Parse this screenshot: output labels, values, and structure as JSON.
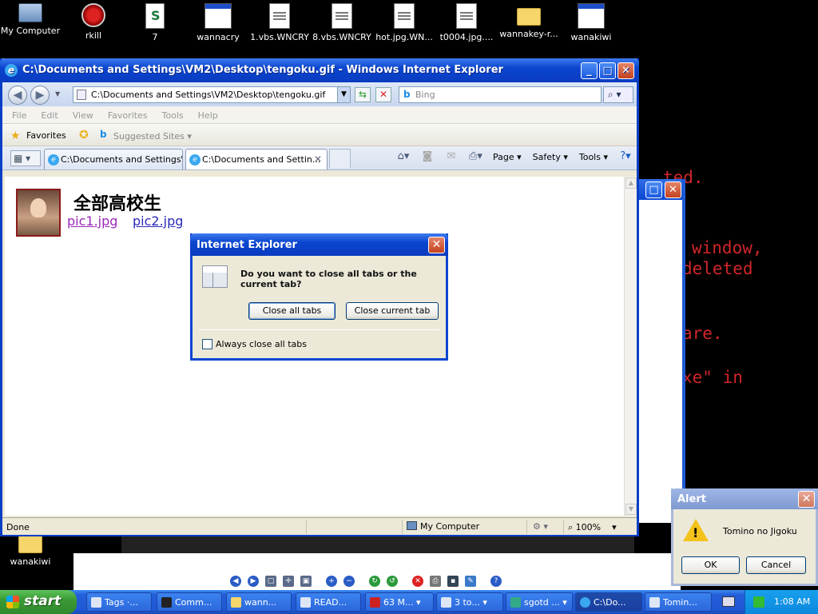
{
  "desktop": {
    "icons": [
      {
        "label": "My Computer",
        "icon": "computer-icon"
      },
      {
        "label": "rkill",
        "icon": "rkill-icon"
      },
      {
        "label": "7",
        "icon": "script-icon"
      },
      {
        "label": "wannacry",
        "icon": "window-app-icon"
      },
      {
        "label": "1.vbs.WNCRY",
        "icon": "document-icon"
      },
      {
        "label": "8.vbs.WNCRY",
        "icon": "document-icon"
      },
      {
        "label": "hot.jpg.WN...",
        "icon": "document-icon"
      },
      {
        "label": "t0004.jpg....",
        "icon": "document-icon"
      },
      {
        "label": "wannakey-r...",
        "icon": "folder-icon"
      },
      {
        "label": "wanakiwi",
        "icon": "window-app-icon"
      }
    ],
    "bottom_icon": {
      "label": "wanakiwi"
    },
    "background_text": [
      "ted.",
      "window,",
      "deleted",
      "are.",
      "xe\" in"
    ]
  },
  "ie": {
    "title": "C:\\Documents and Settings\\VM2\\Desktop\\tengoku.gif - Windows Internet Explorer",
    "address": "C:\\Documents and Settings\\VM2\\Desktop\\tengoku.gif",
    "search_placeholder": "Bing",
    "menu": [
      "File",
      "Edit",
      "View",
      "Favorites",
      "Tools",
      "Help"
    ],
    "favorites_label": "Favorites",
    "suggested_sites": "Suggested Sites",
    "tabs": [
      {
        "label": "C:\\Documents and Settings\\..."
      },
      {
        "label": "C:\\Documents and Settin..."
      }
    ],
    "commands": {
      "page": "Page",
      "safety": "Safety",
      "tools": "Tools"
    },
    "content": {
      "heading": "全部高校生",
      "link1": "pic1.jpg",
      "link2": "pic2.jpg"
    },
    "status": {
      "text": "Done",
      "zone": "My Computer",
      "zoom": "100%"
    }
  },
  "ie_dialog": {
    "title": "Internet Explorer",
    "message": "Do you want to close all tabs or the current tab?",
    "close_all": "Close all tabs",
    "close_current": "Close current tab",
    "checkbox_label": "Always close all tabs"
  },
  "alert": {
    "title": "Alert",
    "message": "Tomino no Jigoku",
    "ok": "OK",
    "cancel": "Cancel"
  },
  "taskbar": {
    "start": "start",
    "tasks": [
      {
        "label": "Tags ·..."
      },
      {
        "label": "Comm..."
      },
      {
        "label": "wann..."
      },
      {
        "label": "READ..."
      },
      {
        "label": "63 M..."
      },
      {
        "label": "3 to..."
      },
      {
        "label": "sgotd ..."
      },
      {
        "label": "C:\\Do..."
      },
      {
        "label": "Tomin..."
      }
    ],
    "clock": "1:08 AM"
  },
  "colors": {
    "xp_blue": "#0a46d0",
    "start_green": "#3a9a35",
    "console_red": "#d0262a"
  }
}
